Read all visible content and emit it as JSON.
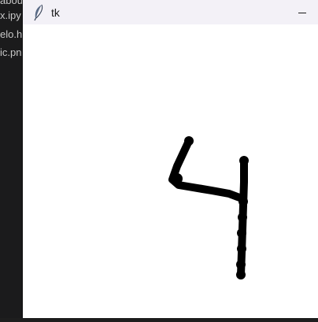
{
  "background_editor": {
    "files": [
      "abou",
      "x.ipy",
      "elo.h",
      "ic.pn"
    ]
  },
  "window": {
    "title": "tk",
    "icon": "feather-icon",
    "minimize_icon": "minimize-icon"
  },
  "canvas": {
    "background": "#ffffff",
    "stroke_color": "#000000",
    "drawn_digit": "4"
  }
}
